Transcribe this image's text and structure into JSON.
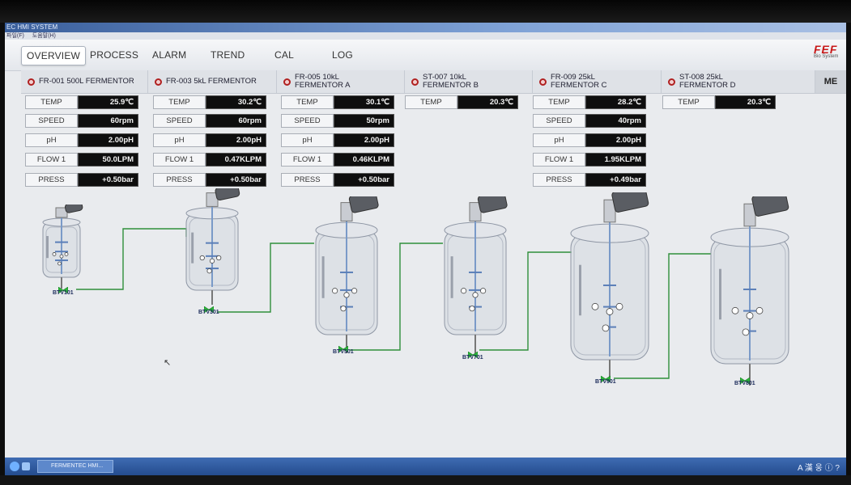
{
  "window": {
    "title": "EC HMI SYSTEM",
    "menu": [
      "파일(F)",
      "도움말(H)"
    ]
  },
  "nav": {
    "tabs": [
      "OVERVIEW",
      "PROCESS",
      "ALARM",
      "TREND",
      "CAL",
      "LOG"
    ],
    "active": "OVERVIEW"
  },
  "brand": {
    "logo_text": "FEF",
    "sub_text": "Bio System"
  },
  "header": {
    "right_button": "ME"
  },
  "fermentors": [
    {
      "name_line1": "FR-001 500L FERMENTOR",
      "name_line2": "",
      "valve": "BTV101",
      "params": [
        {
          "label": "TEMP",
          "value": "25.9℃"
        },
        {
          "label": "SPEED",
          "value": "60rpm"
        },
        {
          "label": "pH",
          "value": "2.00pH"
        },
        {
          "label": "FLOW 1",
          "value": "50.0LPM"
        },
        {
          "label": "PRESS",
          "value": "+0.50bar"
        }
      ]
    },
    {
      "name_line1": "FR-003 5kL FERMENTOR",
      "name_line2": "",
      "valve": "BTV301",
      "params": [
        {
          "label": "TEMP",
          "value": "30.2℃"
        },
        {
          "label": "SPEED",
          "value": "60rpm"
        },
        {
          "label": "pH",
          "value": "2.00pH"
        },
        {
          "label": "FLOW 1",
          "value": "0.47KLPM"
        },
        {
          "label": "PRESS",
          "value": "+0.50bar"
        }
      ]
    },
    {
      "name_line1": "FR-005 10kL",
      "name_line2": "FERMENTOR A",
      "valve": "BTV501",
      "params": [
        {
          "label": "TEMP",
          "value": "30.1℃"
        },
        {
          "label": "SPEED",
          "value": "50rpm"
        },
        {
          "label": "pH",
          "value": "2.00pH"
        },
        {
          "label": "FLOW 1",
          "value": "0.46KLPM"
        },
        {
          "label": "PRESS",
          "value": "+0.50bar"
        }
      ]
    },
    {
      "name_line1": "ST-007 10kL",
      "name_line2": "FERMENTOR B",
      "valve": "BTV701",
      "params": [
        {
          "label": "TEMP",
          "value": "20.3℃"
        }
      ]
    },
    {
      "name_line1": "FR-009 25kL",
      "name_line2": "FERMENTOR C",
      "valve": "BTV901",
      "params": [
        {
          "label": "TEMP",
          "value": "28.2℃"
        },
        {
          "label": "SPEED",
          "value": "40rpm"
        },
        {
          "label": "pH",
          "value": "2.00pH"
        },
        {
          "label": "FLOW 1",
          "value": "1.95KLPM"
        },
        {
          "label": "PRESS",
          "value": "+0.49bar"
        }
      ]
    },
    {
      "name_line1": "ST-008 25kL",
      "name_line2": "FERMENTOR D",
      "valve": "BTV801",
      "params": [
        {
          "label": "TEMP",
          "value": "20.3℃"
        }
      ]
    }
  ],
  "taskbar": {
    "task_label": "FERMENTEC HMI...",
    "tray_text": "A 漢 웅 ⓘ ?"
  },
  "colors": {
    "pipe": "#2f8f3a",
    "valve": "#2db83a",
    "led": "#b02020",
    "value_bg": "#0e0e0e"
  }
}
